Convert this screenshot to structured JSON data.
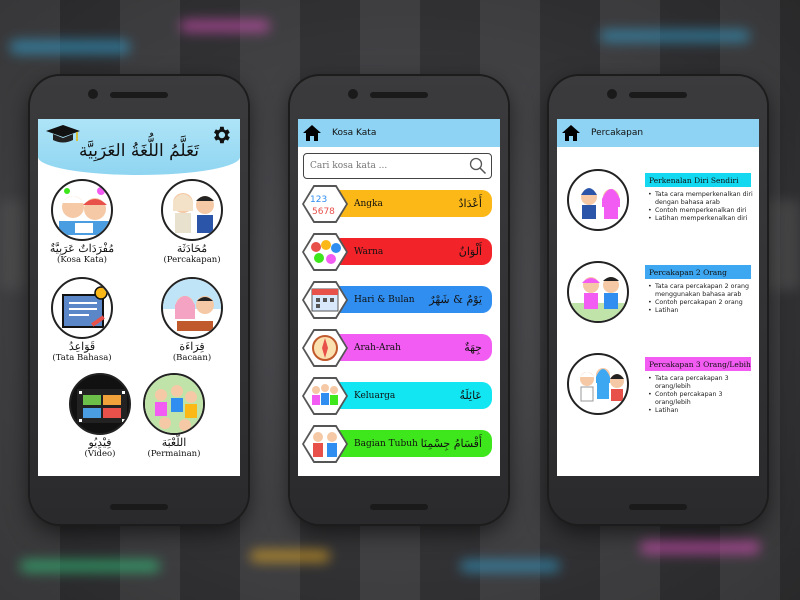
{
  "home": {
    "title": "تَعَلَّمُ اللُّغَةُ العَرَبِيَّة",
    "menu": [
      {
        "ar": "مُفْرَدَاتٌ عَرَبِيَّةٌ",
        "lat": "(Kosa Kata)"
      },
      {
        "ar": "مُحَادَثَة",
        "lat": "(Percakapan)"
      },
      {
        "ar": "قَوَاعِدُ",
        "lat": "(Tata Bahasa)"
      },
      {
        "ar": "قِرَاءَة",
        "lat": "(Bacaan)"
      },
      {
        "ar": "فِيْدِيُو",
        "lat": "(Video)"
      },
      {
        "ar": "اللُّعْبَة",
        "lat": "(Permainan)"
      }
    ]
  },
  "kosa_kata": {
    "title": "Kosa Kata",
    "search_placeholder": "Cari kosa kata ...",
    "categories": [
      {
        "lat": "Angka",
        "ar": "أَعْدَادٌ",
        "color": "#fbb817"
      },
      {
        "lat": "Warna",
        "ar": "أَلْوَانٌ",
        "color": "#f2242a"
      },
      {
        "lat": "Hari & Bulan",
        "ar": "يَوْمٌ & شَهْرٌ",
        "color": "#2f8ef0"
      },
      {
        "lat": "Arah-Arah",
        "ar": "جِهَةٌ",
        "color": "#f25cf2"
      },
      {
        "lat": "Keluarga",
        "ar": "عَائِلَةٌ",
        "color": "#11e6f2"
      },
      {
        "lat": "Bagian Tubuh",
        "ar": "أَقْسَامُ جِسْمِنَا",
        "color": "#3ee61c"
      }
    ]
  },
  "percakapan": {
    "title": "Percakapan",
    "items": [
      {
        "tag": "Perkenalan Diri Sendiri",
        "tag_color": "#14d7f0",
        "points": [
          "Tata cara memperkenalkan diri dengan bahasa arab",
          "Contoh memperkenalkan diri",
          "Latihan memperkenalkan diri"
        ]
      },
      {
        "tag": "Percakapan 2 Orang",
        "tag_color": "#3ea7f2",
        "points": [
          "Tata cara percakapan 2 orang menggunakan bahasa arab",
          "Contoh percakapan 2 orang",
          "Latihan"
        ]
      },
      {
        "tag": "Percakapan 3 Orang/Lebih",
        "tag_color": "#f25cf2",
        "points": [
          "Tata cara percakapan 3 orang/lebih",
          "Contoh percakapan 3 orang/lebih",
          "Latihan"
        ]
      }
    ]
  },
  "colors": {
    "appbar": "#8ed3f3",
    "home_header": "#9edcf4"
  },
  "icons": [
    "graduation-cap-icon",
    "gear-icon",
    "home-icon",
    "search-icon"
  ]
}
